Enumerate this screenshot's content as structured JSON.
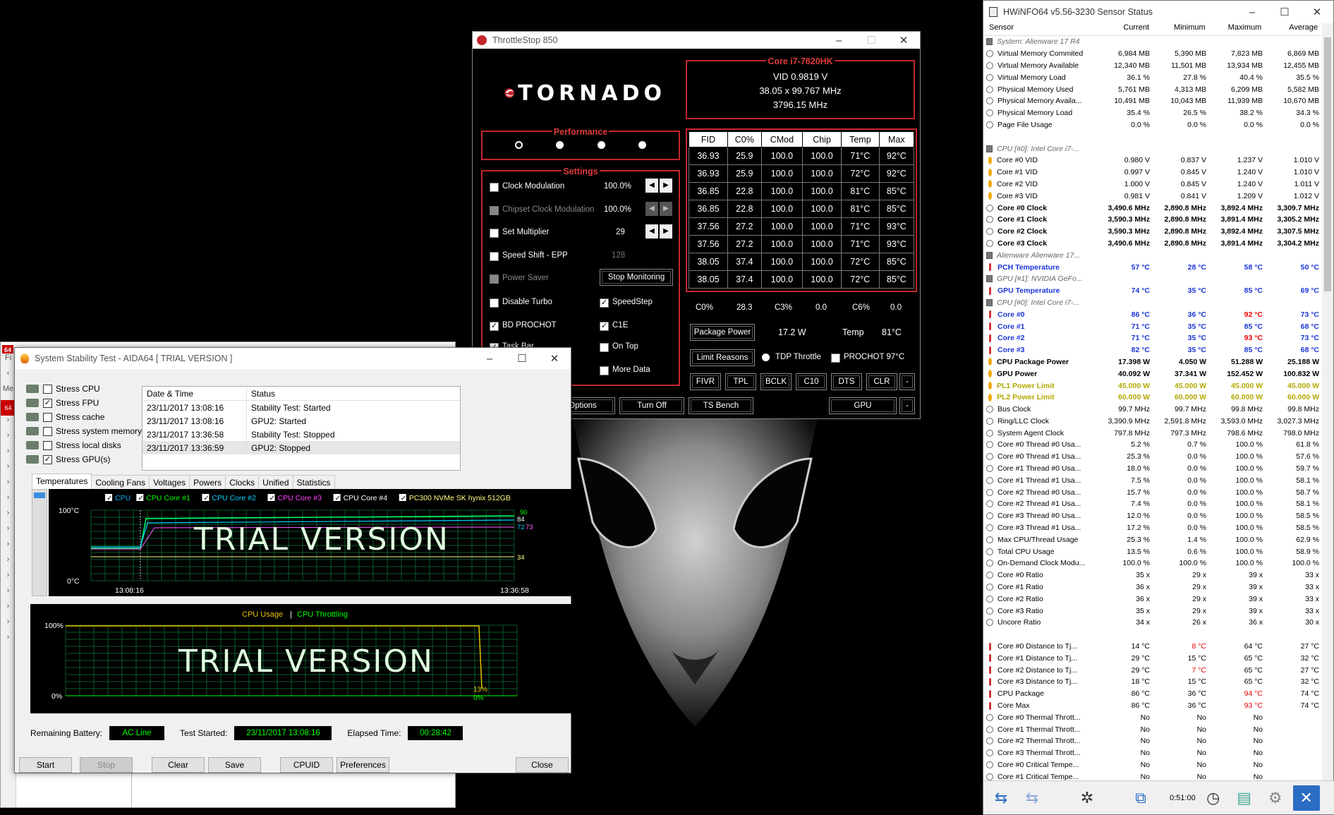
{
  "aida_bg": {
    "menu": [
      "Fi",
      "Me"
    ],
    "badge": "64"
  },
  "stability": {
    "title": "System Stability Test - AIDA64  [ TRIAL VERSION ]",
    "checks": [
      {
        "label": "Stress CPU",
        "checked": false
      },
      {
        "label": "Stress FPU",
        "checked": true
      },
      {
        "label": "Stress cache",
        "checked": false
      },
      {
        "label": "Stress system memory",
        "checked": false
      },
      {
        "label": "Stress local disks",
        "checked": false
      },
      {
        "label": "Stress GPU(s)",
        "checked": true
      }
    ],
    "log_headers": [
      "Date & Time",
      "Status"
    ],
    "log": [
      {
        "time": "23/11/2017 13:08:16",
        "status": "Stability Test: Started"
      },
      {
        "time": "23/11/2017 13:08:16",
        "status": "GPU2: Started"
      },
      {
        "time": "23/11/2017 13:36:58",
        "status": "Stability Test: Stopped"
      },
      {
        "time": "23/11/2017 13:36:59",
        "status": "GPU2: Stopped"
      }
    ],
    "tabs": [
      "Temperatures",
      "Cooling Fans",
      "Voltages",
      "Powers",
      "Clocks",
      "Unified",
      "Statistics"
    ],
    "temp_legend": [
      {
        "label": "CPU",
        "color": "#00b4ff"
      },
      {
        "label": "CPU Core #1",
        "color": "#00ff00"
      },
      {
        "label": "CPU Core #2",
        "color": "#00d0ff"
      },
      {
        "label": "CPU Core #3",
        "color": "#ff40ff"
      },
      {
        "label": "CPU Core #4",
        "color": "#ffffff"
      },
      {
        "label": "PC300 NVMe SK hynix 512GB",
        "color": "#ffff80"
      }
    ],
    "temp_axis": {
      "top": "100°C",
      "bottom": "0°C",
      "start": "13:08:16",
      "end": "13:36:58"
    },
    "temp_values": {
      "v1": "90",
      "v2": "84",
      "v3": "72",
      "v4": "73",
      "v5": "34"
    },
    "usage_legend": {
      "a": "CPU Usage",
      "sep": "|",
      "b": "CPU Throttling"
    },
    "usage_axis": {
      "top": "100%",
      "bottom": "0%"
    },
    "usage_values": {
      "v1": "13%",
      "v2": "0%"
    },
    "watermark": "TRIAL VERSION",
    "status": {
      "battery_label": "Remaining Battery:",
      "battery": "AC Line",
      "started_label": "Test Started:",
      "started": "23/11/2017 13:08:16",
      "elapsed_label": "Elapsed Time:",
      "elapsed": "00:28:42"
    },
    "buttons": {
      "start": "Start",
      "stop": "Stop",
      "clear": "Clear",
      "save": "Save",
      "cpuid": "CPUID",
      "prefs": "Preferences",
      "close": "Close"
    }
  },
  "throttlestop": {
    "title": "ThrottleStop 850",
    "logo": "TORNADO",
    "cpu": "Core i7-7820HK",
    "vid": "VID  0.9819 V",
    "mult": "38.05 x 99.767 MHz",
    "mhz": "3796.15 MHz",
    "perf_label": "Performance",
    "settings_label": "Settings",
    "clock_mod": "Clock Modulation",
    "clock_mod_val": "100.0%",
    "chipset_mod": "Chipset Clock Modulation",
    "chipset_mod_val": "100.0%",
    "set_mult": "Set Multiplier",
    "set_mult_val": "29",
    "speed_shift": "Speed Shift - EPP",
    "speed_shift_val": "128",
    "power_saver": "Power Saver",
    "stop_mon": "Stop Monitoring",
    "disable_turbo": "Disable Turbo",
    "speedstep": "SpeedStep",
    "bd_prochot": "BD PROCHOT",
    "c1e": "C1E",
    "task_bar": "Task Bar",
    "on_top": "On Top",
    "more_data": "More Data",
    "table_headers": [
      "FID",
      "C0%",
      "CMod",
      "Chip",
      "Temp",
      "Max"
    ],
    "table_rows": [
      [
        "36.93",
        "25.9",
        "100.0",
        "100.0",
        "71°C",
        "92°C"
      ],
      [
        "36.93",
        "25.9",
        "100.0",
        "100.0",
        "72°C",
        "92°C"
      ],
      [
        "36.85",
        "22.8",
        "100.0",
        "100.0",
        "81°C",
        "85°C"
      ],
      [
        "36.85",
        "22.8",
        "100.0",
        "100.0",
        "81°C",
        "85°C"
      ],
      [
        "37.56",
        "27.2",
        "100.0",
        "100.0",
        "71°C",
        "93°C"
      ],
      [
        "37.56",
        "27.2",
        "100.0",
        "100.0",
        "71°C",
        "93°C"
      ],
      [
        "38.05",
        "37.4",
        "100.0",
        "100.0",
        "72°C",
        "85°C"
      ],
      [
        "38.05",
        "37.4",
        "100.0",
        "100.0",
        "72°C",
        "85°C"
      ]
    ],
    "c0": "C0%",
    "c0v": "28.3",
    "c3": "C3%",
    "c3v": "0.0",
    "c6": "C6%",
    "c6v": "0.0",
    "pkg_power": "Package Power",
    "pkg_val": "17.2 W",
    "temp_label": "Temp",
    "temp_val": "81°C",
    "limit_reasons": "Limit Reasons",
    "tdp_throttle": "TDP Throttle",
    "prochot": "PROCHOT 97°C",
    "row_btns": [
      "FIVR",
      "TPL",
      "BCLK",
      "C10",
      "DTS",
      "CLR",
      "-"
    ],
    "options": "Options",
    "turn_off": "Turn Off",
    "ts_bench": "TS Bench",
    "gpu": "GPU",
    "dash": "-"
  },
  "hwinfo": {
    "title": "HWiNFO64 v5.56-3230 Sensor Status",
    "headers": [
      "Sensor",
      "Current",
      "Minimum",
      "Maximum",
      "Average"
    ],
    "rows": [
      {
        "t": "grp",
        "n": "System: Alienware 17 R4"
      },
      {
        "t": "c",
        "n": "Virtual Memory Commited",
        "v": [
          "6,984 MB",
          "5,390 MB",
          "7,823 MB",
          "6,869 MB"
        ]
      },
      {
        "t": "c",
        "n": "Virtual Memory Available",
        "v": [
          "12,340 MB",
          "11,501 MB",
          "13,934 MB",
          "12,455 MB"
        ]
      },
      {
        "t": "c",
        "n": "Virtual Memory Load",
        "v": [
          "36.1 %",
          "27.8 %",
          "40.4 %",
          "35.5 %"
        ]
      },
      {
        "t": "c",
        "n": "Physical Memory Used",
        "v": [
          "5,761 MB",
          "4,313 MB",
          "6,209 MB",
          "5,582 MB"
        ]
      },
      {
        "t": "c",
        "n": "Physical Memory Availa...",
        "v": [
          "10,491 MB",
          "10,043 MB",
          "11,939 MB",
          "10,670 MB"
        ]
      },
      {
        "t": "c",
        "n": "Physical Memory Load",
        "v": [
          "35.4 %",
          "26.5 %",
          "38.2 %",
          "34.3 %"
        ]
      },
      {
        "t": "c",
        "n": "Page File Usage",
        "v": [
          "0.0 %",
          "0.0 %",
          "0.0 %",
          "0.0 %"
        ]
      },
      {
        "t": "blank"
      },
      {
        "t": "grp",
        "n": "CPU [#0]: Intel Core i7-..."
      },
      {
        "t": "volt",
        "n": "Core #0 VID",
        "v": [
          "0.980 V",
          "0.837 V",
          "1.237 V",
          "1.010 V"
        ]
      },
      {
        "t": "volt",
        "n": "Core #1 VID",
        "v": [
          "0.997 V",
          "0.845 V",
          "1.240 V",
          "1.010 V"
        ]
      },
      {
        "t": "volt",
        "n": "Core #2 VID",
        "v": [
          "1.000 V",
          "0.845 V",
          "1.240 V",
          "1.011 V"
        ]
      },
      {
        "t": "volt",
        "n": "Core #3 VID",
        "v": [
          "0.981 V",
          "0.841 V",
          "1.209 V",
          "1.012 V"
        ]
      },
      {
        "t": "c",
        "s": "bold",
        "n": "Core #0 Clock",
        "v": [
          "3,490.6 MHz",
          "2,890.8 MHz",
          "3,892.4 MHz",
          "3,309.7 MHz"
        ]
      },
      {
        "t": "c",
        "s": "bold",
        "n": "Core #1 Clock",
        "v": [
          "3,590.3 MHz",
          "2,890.8 MHz",
          "3,891.4 MHz",
          "3,305.2 MHz"
        ]
      },
      {
        "t": "c",
        "s": "bold",
        "n": "Core #2 Clock",
        "v": [
          "3,590.3 MHz",
          "2,890.8 MHz",
          "3,892.4 MHz",
          "3,307.5 MHz"
        ]
      },
      {
        "t": "c",
        "s": "bold",
        "n": "Core #3 Clock",
        "v": [
          "3,490.6 MHz",
          "2,890.8 MHz",
          "3,891.4 MHz",
          "3,304.2 MHz"
        ]
      },
      {
        "t": "grp",
        "n": "Alienware Alienware 17..."
      },
      {
        "t": "therm",
        "s": "blue",
        "n": "PCH Temperature",
        "v": [
          "57 °C",
          "28 °C",
          "58 °C",
          "50 °C"
        ]
      },
      {
        "t": "grp",
        "n": "GPU [#1]: NVIDIA GeFo..."
      },
      {
        "t": "therm",
        "s": "blue",
        "n": "GPU Temperature",
        "v": [
          "74 °C",
          "35 °C",
          "85 °C",
          "69 °C"
        ]
      },
      {
        "t": "grp",
        "n": "CPU [#0]: Intel Core i7-..."
      },
      {
        "t": "therm",
        "s": "blue",
        "n": "Core #0",
        "v": [
          "86 °C",
          "36 °C",
          "92 °C",
          "73 °C"
        ],
        "r": [
          2
        ]
      },
      {
        "t": "therm",
        "s": "blue",
        "n": "Core #1",
        "v": [
          "71 °C",
          "35 °C",
          "85 °C",
          "68 °C"
        ]
      },
      {
        "t": "therm",
        "s": "blue",
        "n": "Core #2",
        "v": [
          "71 °C",
          "35 °C",
          "93 °C",
          "73 °C"
        ],
        "r": [
          2
        ]
      },
      {
        "t": "therm",
        "s": "blue",
        "n": "Core #3",
        "v": [
          "82 °C",
          "35 °C",
          "85 °C",
          "68 °C"
        ]
      },
      {
        "t": "volt",
        "s": "bold",
        "n": "CPU Package Power",
        "v": [
          "17.398 W",
          "4.050 W",
          "51.288 W",
          "25.188 W"
        ]
      },
      {
        "t": "volt",
        "s": "bold",
        "n": "GPU Power",
        "v": [
          "40.092 W",
          "37.341 W",
          "152.452 W",
          "100.832 W"
        ]
      },
      {
        "t": "volt",
        "s": "olive",
        "n": "PL1 Power Limit",
        "v": [
          "45.000 W",
          "45.000 W",
          "45.000 W",
          "45.000 W"
        ]
      },
      {
        "t": "volt",
        "s": "olive",
        "n": "PL2 Power Limit",
        "v": [
          "60.000 W",
          "60.000 W",
          "60.000 W",
          "60.000 W"
        ]
      },
      {
        "t": "c",
        "n": "Bus Clock",
        "v": [
          "99.7 MHz",
          "99.7 MHz",
          "99.8 MHz",
          "99.8 MHz"
        ]
      },
      {
        "t": "c",
        "n": "Ring/LLC Clock",
        "v": [
          "3,390.9 MHz",
          "2,591.8 MHz",
          "3,593.0 MHz",
          "3,027.3 MHz"
        ]
      },
      {
        "t": "c",
        "n": "System Agent Clock",
        "v": [
          "797.8 MHz",
          "797.3 MHz",
          "798.6 MHz",
          "798.0 MHz"
        ]
      },
      {
        "t": "c",
        "n": "Core #0 Thread #0 Usa...",
        "v": [
          "5.2 %",
          "0.7 %",
          "100.0 %",
          "61.8 %"
        ]
      },
      {
        "t": "c",
        "n": "Core #0 Thread #1 Usa...",
        "v": [
          "25.3 %",
          "0.0 %",
          "100.0 %",
          "57.6 %"
        ]
      },
      {
        "t": "c",
        "n": "Core #1 Thread #0 Usa...",
        "v": [
          "18.0 %",
          "0.0 %",
          "100.0 %",
          "59.7 %"
        ]
      },
      {
        "t": "c",
        "n": "Core #1 Thread #1 Usa...",
        "v": [
          "7.5 %",
          "0.0 %",
          "100.0 %",
          "58.1 %"
        ]
      },
      {
        "t": "c",
        "n": "Core #2 Thread #0 Usa...",
        "v": [
          "15.7 %",
          "0.0 %",
          "100.0 %",
          "58.7 %"
        ]
      },
      {
        "t": "c",
        "n": "Core #2 Thread #1 Usa...",
        "v": [
          "7.4 %",
          "0.0 %",
          "100.0 %",
          "58.1 %"
        ]
      },
      {
        "t": "c",
        "n": "Core #3 Thread #0 Usa...",
        "v": [
          "12.0 %",
          "0.0 %",
          "100.0 %",
          "58.5 %"
        ]
      },
      {
        "t": "c",
        "n": "Core #3 Thread #1 Usa...",
        "v": [
          "17.2 %",
          "0.0 %",
          "100.0 %",
          "58.5 %"
        ]
      },
      {
        "t": "c",
        "n": "Max CPU/Thread Usage",
        "v": [
          "25.3 %",
          "1.4 %",
          "100.0 %",
          "62.9 %"
        ]
      },
      {
        "t": "c",
        "n": "Total CPU Usage",
        "v": [
          "13.5 %",
          "0.6 %",
          "100.0 %",
          "58.9 %"
        ]
      },
      {
        "t": "c",
        "n": "On-Demand Clock Modu...",
        "v": [
          "100.0 %",
          "100.0 %",
          "100.0 %",
          "100.0 %"
        ]
      },
      {
        "t": "c",
        "n": "Core #0 Ratio",
        "v": [
          "35 x",
          "29 x",
          "39 x",
          "33 x"
        ]
      },
      {
        "t": "c",
        "n": "Core #1 Ratio",
        "v": [
          "36 x",
          "29 x",
          "39 x",
          "33 x"
        ]
      },
      {
        "t": "c",
        "n": "Core #2 Ratio",
        "v": [
          "36 x",
          "29 x",
          "39 x",
          "33 x"
        ]
      },
      {
        "t": "c",
        "n": "Core #3 Ratio",
        "v": [
          "35 x",
          "29 x",
          "39 x",
          "33 x"
        ]
      },
      {
        "t": "c",
        "n": "Uncore Ratio",
        "v": [
          "34 x",
          "26 x",
          "36 x",
          "30 x"
        ]
      },
      {
        "t": "blank"
      },
      {
        "t": "therm",
        "n": "Core #0 Distance to Tj...",
        "v": [
          "14 °C",
          "8 °C",
          "64 °C",
          "27 °C"
        ],
        "r": [
          1
        ]
      },
      {
        "t": "therm",
        "n": "Core #1 Distance to Tj...",
        "v": [
          "29 °C",
          "15 °C",
          "65 °C",
          "32 °C"
        ]
      },
      {
        "t": "therm",
        "n": "Core #2 Distance to Tj...",
        "v": [
          "29 °C",
          "7 °C",
          "65 °C",
          "27 °C"
        ],
        "r": [
          1
        ]
      },
      {
        "t": "therm",
        "n": "Core #3 Distance to Tj...",
        "v": [
          "18 °C",
          "15 °C",
          "65 °C",
          "32 °C"
        ]
      },
      {
        "t": "therm",
        "n": "CPU Package",
        "v": [
          "86 °C",
          "36 °C",
          "94 °C",
          "74 °C"
        ],
        "r": [
          2
        ]
      },
      {
        "t": "therm",
        "n": "Core Max",
        "v": [
          "86 °C",
          "36 °C",
          "93 °C",
          "74 °C"
        ],
        "r": [
          2
        ]
      },
      {
        "t": "c",
        "n": "Core #0 Thermal Thrott...",
        "v": [
          "No",
          "No",
          "No",
          ""
        ]
      },
      {
        "t": "c",
        "n": "Core #1 Thermal Thrott...",
        "v": [
          "No",
          "No",
          "No",
          ""
        ]
      },
      {
        "t": "c",
        "n": "Core #2 Thermal Thrott...",
        "v": [
          "No",
          "No",
          "No",
          ""
        ]
      },
      {
        "t": "c",
        "n": "Core #3 Thermal Thrott...",
        "v": [
          "No",
          "No",
          "No",
          ""
        ]
      },
      {
        "t": "c",
        "n": "Core #0 Critical Tempe...",
        "v": [
          "No",
          "No",
          "No",
          ""
        ]
      },
      {
        "t": "c",
        "n": "Core #1 Critical Tempe...",
        "v": [
          "No",
          "No",
          "No",
          ""
        ]
      }
    ],
    "timer": "0:51:00"
  }
}
